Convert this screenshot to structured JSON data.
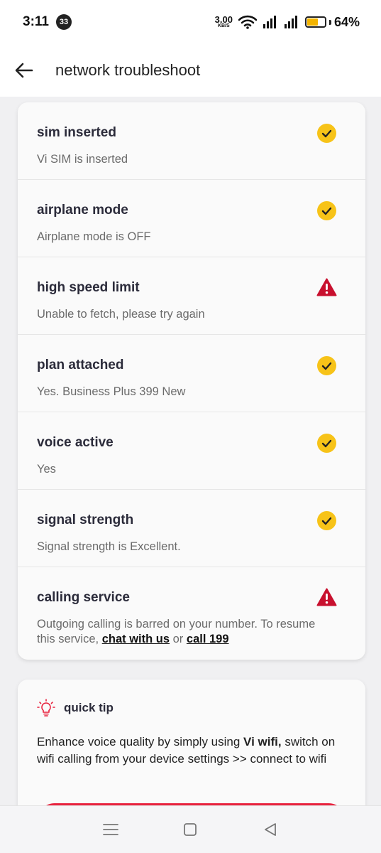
{
  "status_bar": {
    "time": "3:11",
    "notification_count": "33",
    "net_speed_value": "3.00",
    "net_speed_unit": "KB/S",
    "battery_percent": "64%",
    "battery_level": 0.64,
    "battery_color": "#f4b400"
  },
  "header": {
    "back_icon": "arrow-left-icon",
    "title": "network troubleshoot"
  },
  "checks": [
    {
      "title": "sim inserted",
      "description": "Vi SIM is inserted",
      "status": "ok"
    },
    {
      "title": "airplane mode",
      "description": "Airplane mode is OFF",
      "status": "ok"
    },
    {
      "title": "high speed limit",
      "description": "Unable to fetch, please try again",
      "status": "warning"
    },
    {
      "title": "plan attached",
      "description": "Yes. Business Plus 399 New",
      "status": "ok"
    },
    {
      "title": "voice active",
      "description": "Yes",
      "status": "ok"
    },
    {
      "title": "signal strength",
      "description": "Signal strength is Excellent.",
      "status": "ok"
    },
    {
      "title": "calling service",
      "description_prefix": "Outgoing calling is barred on your number. To resume this service, ",
      "link_chat": "chat with us",
      "description_middle": " or ",
      "link_call": "call 199",
      "status": "warning"
    }
  ],
  "quick_tip": {
    "icon": "lightbulb-icon",
    "title": "quick tip",
    "text_prefix": "Enhance voice quality by simply using ",
    "text_bold": "Vi wifi,",
    "text_suffix": " switch on wifi calling from your device settings >> connect to wifi"
  },
  "colors": {
    "ok": "#f7c318",
    "warning": "#c8102e",
    "accent": "#e8213d"
  },
  "nav_bar": {
    "menu_icon": "menu-icon",
    "home_icon": "home-square-icon",
    "back_icon": "triangle-back-icon"
  }
}
